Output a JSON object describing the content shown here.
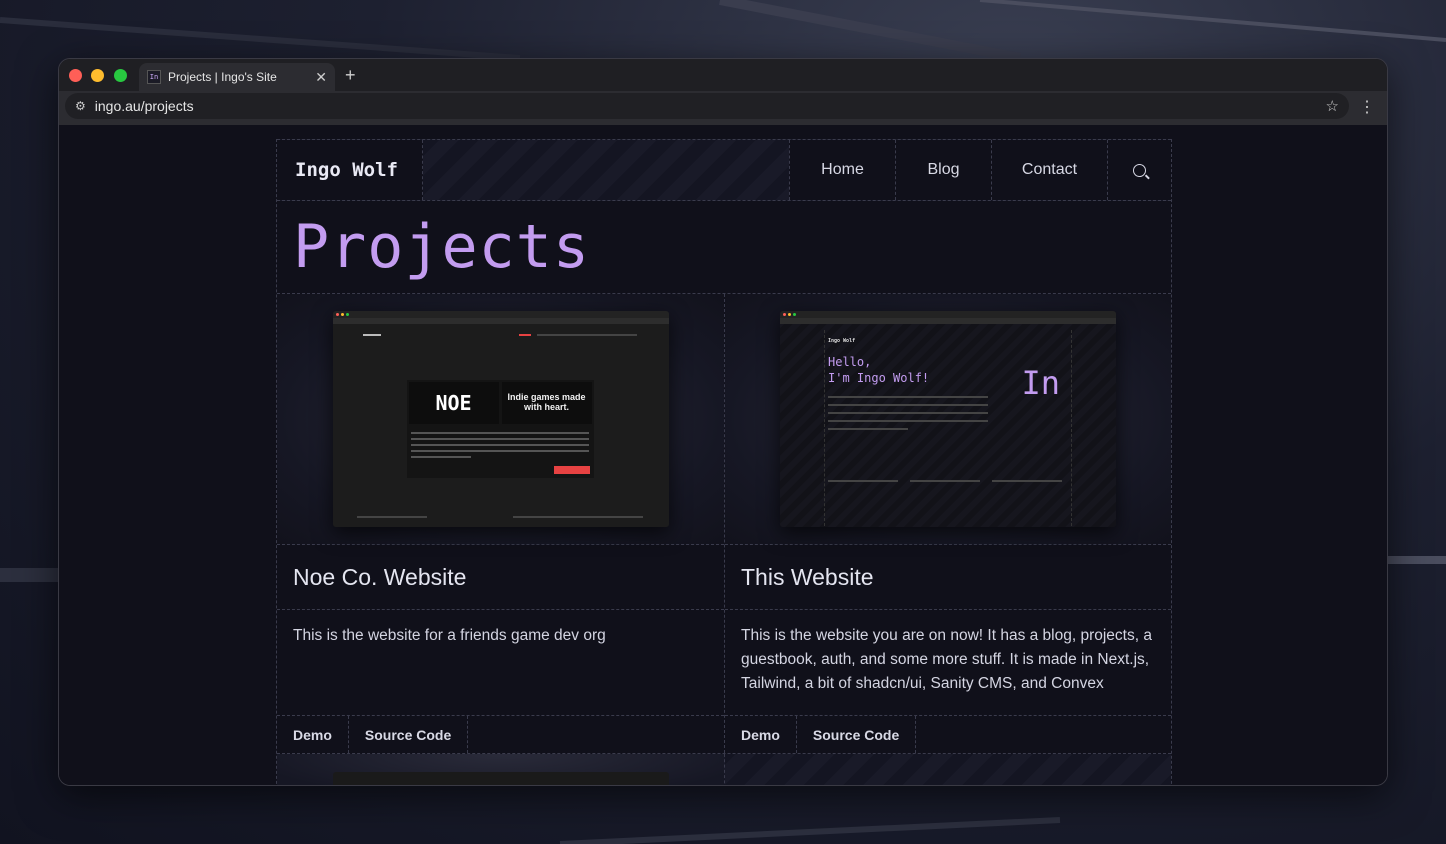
{
  "browser": {
    "tab_title": "Projects | Ingo's Site",
    "tab_favicon": "In",
    "url": "ingo.au/projects"
  },
  "site": {
    "brand": "Ingo Wolf",
    "nav": [
      {
        "label": "Home"
      },
      {
        "label": "Blog"
      },
      {
        "label": "Contact"
      }
    ],
    "page_title": "Projects",
    "projects": [
      {
        "title": "Noe Co. Website",
        "description": "This is the website for a friends game dev org",
        "links": [
          "Demo",
          "Source Code"
        ],
        "preview": {
          "logo": "NOE",
          "tagline": "Indie games made with heart."
        }
      },
      {
        "title": "This Website",
        "description": "This is the website you are on now! It has a blog, projects, a guestbook, auth, and some more stuff. It is made in Next.js, Tailwind, a bit of shadcn/ui, Sanity CMS, and Convex",
        "links": [
          "Demo",
          "Source Code"
        ],
        "preview": {
          "brand": "Ingo Wolf",
          "greeting_1": "Hello,",
          "greeting_2": "I'm Ingo Wolf!",
          "mark": "In"
        }
      }
    ]
  },
  "colors": {
    "accent": "#c39cf0",
    "background": "#10101a",
    "border": "#3a3b4c",
    "red_light": "#ff5f57",
    "yellow_light": "#febc2e",
    "green_light": "#28c840"
  }
}
